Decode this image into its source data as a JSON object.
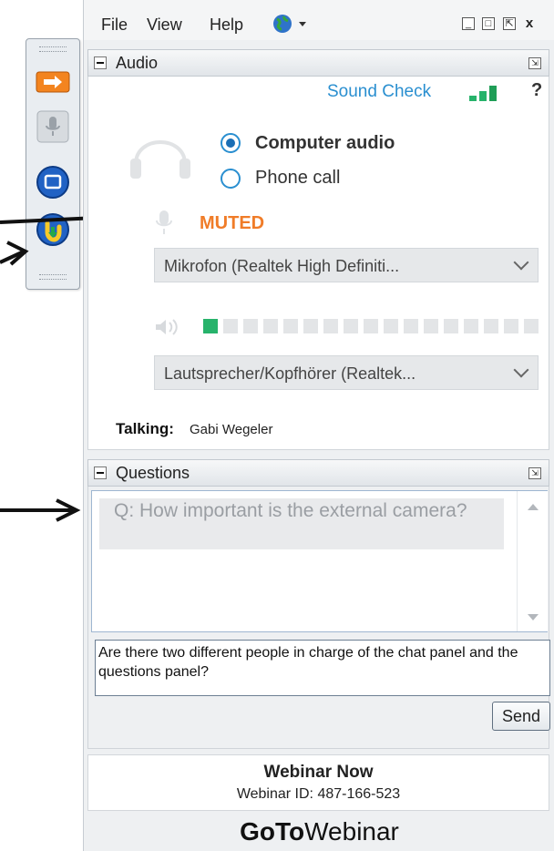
{
  "menu": {
    "file": "File",
    "view": "View",
    "help": "Help"
  },
  "window_controls": {
    "minimize": "_",
    "maximize": "□",
    "popout": "⇱",
    "close": "x"
  },
  "audio": {
    "title": "Audio",
    "sound_check": "Sound Check",
    "help": "?",
    "options": {
      "computer": "Computer audio",
      "phone": "Phone call"
    },
    "selected": "Computer audio",
    "mute_status": "MUTED",
    "microphone": "Mikrofon (Realtek High Definiti...",
    "speaker": "Lautsprecher/Kopfhörer (Realtek...",
    "speaker_level": 0.07,
    "talking_label": "Talking:",
    "talking_name": "Gabi Wegeler"
  },
  "questions": {
    "title": "Questions",
    "items": [
      "Q: How important is the external camera?"
    ],
    "input_value": "Are there two different people in charge of the chat panel and the questions panel?",
    "send_label": "Send"
  },
  "webinar": {
    "title": "Webinar Now",
    "id_text": "Webinar ID: 487-166-523"
  },
  "brand": {
    "goto": "GoTo",
    "webinar": "Webinar"
  },
  "colors": {
    "accent_blue": "#2a8fd0",
    "muted_orange": "#f07c28",
    "level_green": "#27b36b",
    "orange_button": "#f0882a"
  },
  "toolbar_icons": [
    "show-panel-arrow-icon",
    "microphone-icon",
    "screen-icon",
    "raise-hand-icon"
  ]
}
